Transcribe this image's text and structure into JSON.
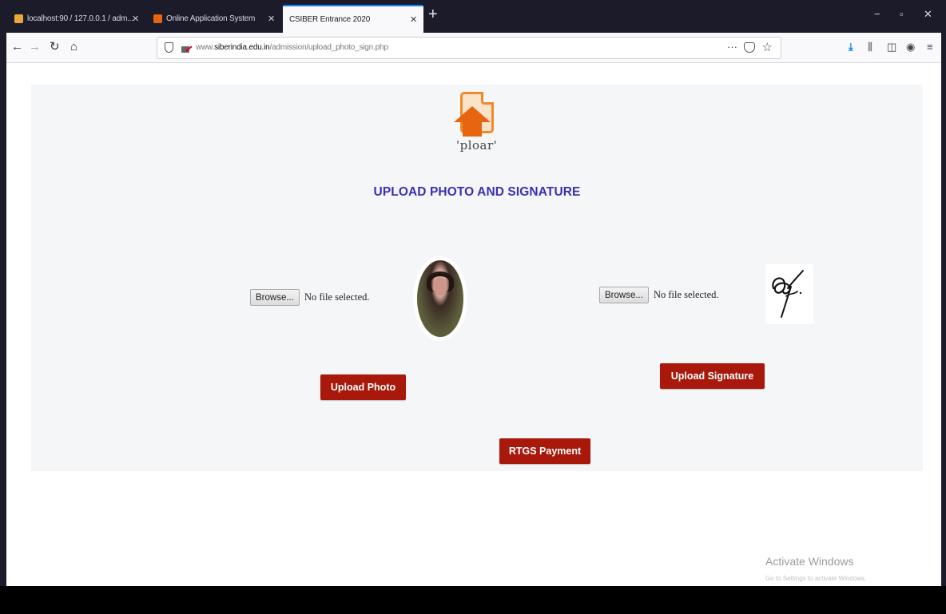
{
  "browser": {
    "tabs": [
      {
        "label": "localhost:90 / 127.0.0.1 / adm...",
        "active": false,
        "favicon_color": "#e9a93a"
      },
      {
        "label": "Online Application System",
        "active": false,
        "favicon_color": "#e8650f"
      },
      {
        "label": "CSIBER Entrance 2020",
        "active": true,
        "favicon_color": ""
      }
    ],
    "new_tab_label": "+",
    "window_controls": [
      "−",
      "▫",
      "✕"
    ],
    "url": {
      "prefix": "www.",
      "domain": "siberindia.edu.in",
      "path": "/admission/upload_photo_sign.php"
    },
    "page_actions_label": "···",
    "toolbar_icons": [
      "download-icon",
      "library-icon",
      "sidebar-icon",
      "account-icon",
      "menu-icon"
    ],
    "colors": {
      "accent": "#0a84ff",
      "chrome": "#1c1b2a"
    }
  },
  "page": {
    "logo_text": "'ploar'",
    "title": "UPLOAD PHOTO AND SIGNATURE",
    "photo_input": {
      "button_label": "Browse...",
      "status": "No file selected."
    },
    "signature_input": {
      "button_label": "Browse...",
      "status": "No file selected."
    },
    "buttons": {
      "upload_photo": "Upload Photo",
      "upload_signature": "Upload Signature",
      "rtgs_payment": "RTGS Payment"
    },
    "colors": {
      "title": "#3a2fb5",
      "button": "#a8190b",
      "logo": "#e8650f"
    }
  },
  "os": {
    "watermark_title": "Activate Windows",
    "watermark_subtitle": "Go to Settings to activate Windows."
  }
}
